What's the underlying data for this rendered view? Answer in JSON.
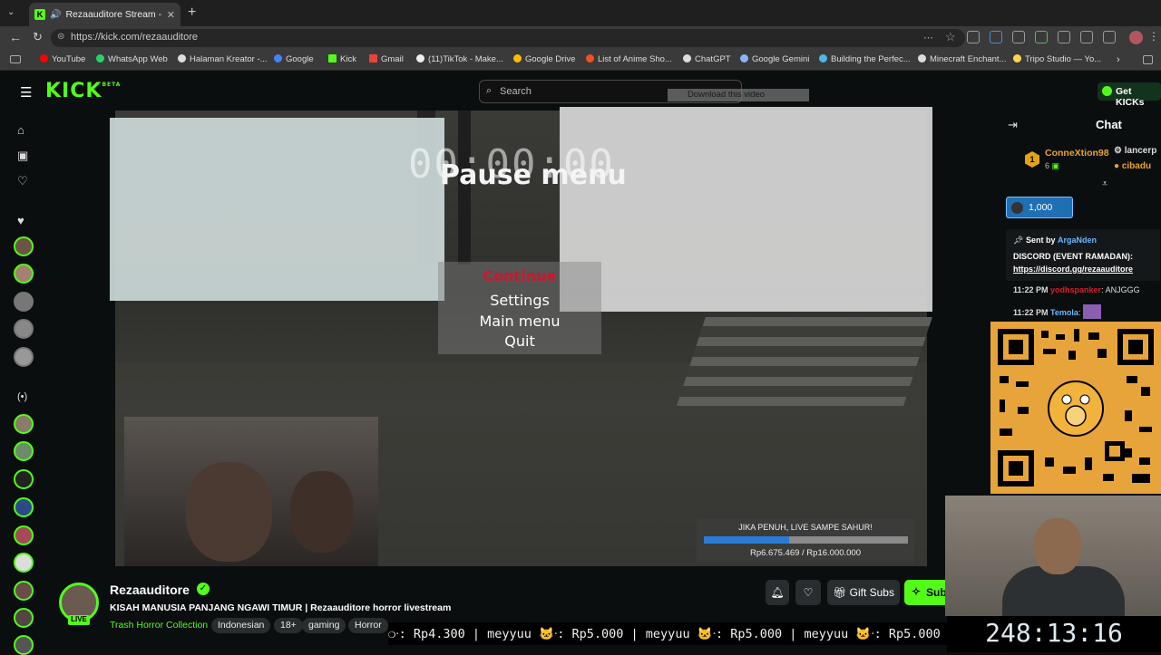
{
  "browser": {
    "tab_title": "Rezaauditore Stream - Watch",
    "url": "https://kick.com/rezaauditore",
    "bookmarks": [
      "YouTube",
      "WhatsApp Web",
      "Halaman Kreator -...",
      "Google",
      "Kick",
      "Gmail",
      "(11)TikTok - Make...",
      "Google Drive",
      "List of Anime Sho...",
      "ChatGPT",
      "Google Gemini",
      "Building the Perfec...",
      "Minecraft Enchant...",
      "Tripo Studio — Yo..."
    ]
  },
  "kick": {
    "logo": "KICK",
    "logo_beta": "BETA",
    "search_placeholder": "Search",
    "download_overlay": "Download this video",
    "get_kicks": "Get KICKs"
  },
  "game": {
    "timer": "00:00:00",
    "pause_title": "Pause menu",
    "menu": [
      "Continue",
      "Settings",
      "Main menu",
      "Quit"
    ],
    "goal_title": "JIKA PENUH, LIVE SAMPE SAHUR!",
    "goal_progress": "Rp6.675.469 / Rp16.000.000",
    "goal_fraction": 0.417
  },
  "stream": {
    "streamer": "Rezaauditore",
    "live": "LIVE",
    "title": "KISAH MANUSIA PANJANG NGAWI TIMUR | Rezaauditore horror livestream",
    "category": "Trash Horror Collection",
    "tags": [
      "Indonesian",
      "18+",
      "gaming",
      "Horror"
    ],
    "gift_subs": "Gift Subs",
    "subscribe": "Sub"
  },
  "ticker": {
    "text": "❍ᐧ: Rp4.300 | meyyuu 🐱ᐧ: Rp5.000 | meyyuu 🐱ᐧ: Rp5.000 | meyyuu 🐱ᐧ: Rp5.000"
  },
  "uptime": "248:13:16",
  "chat": {
    "title": "Chat",
    "top_gifter": {
      "rank": "1",
      "name": "ConneXtion98",
      "count": "6"
    },
    "other_gifters": [
      "lancerp",
      "cibadu"
    ],
    "kicks_amount": "1,000",
    "pinned": {
      "sent_by_label": "Sent by",
      "sender": "ArgaNden",
      "line1": "DISCORD (EVENT RAMADAN):",
      "link": "https://discord.gg/rezaauditore"
    },
    "messages": [
      {
        "time": "11:22 PM",
        "user": "yodhspanker",
        "text": ": ANJGGG",
        "color": "#d61f2f"
      },
      {
        "time": "11:22 PM",
        "user": "Temola",
        "text": ":",
        "color": "#6ab7ff"
      }
    ]
  },
  "colors": {
    "accent": "#53fc18",
    "goal_fill": "#2b7bd6",
    "continue": "#d3142a"
  }
}
